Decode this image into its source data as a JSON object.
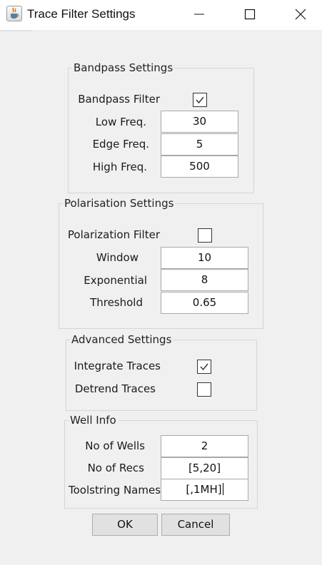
{
  "window": {
    "title": "Trace Filter Settings",
    "app_icon": "java-cup-icon"
  },
  "bandpass": {
    "legend": "Bandpass Settings",
    "filter_label": "Bandpass Filter",
    "filter_checked": true,
    "low_label": "Low Freq.",
    "low_value": "30",
    "edge_label": "Edge Freq.",
    "edge_value": "5",
    "high_label": "High Freq.",
    "high_value": "500"
  },
  "polarisation": {
    "legend": "Polarisation Settings",
    "filter_label": "Polarization Filter",
    "filter_checked": false,
    "window_label": "Window",
    "window_value": "10",
    "exponential_label": "Exponential",
    "exponential_value": "8",
    "threshold_label": "Threshold",
    "threshold_value": "0.65"
  },
  "advanced": {
    "legend": "Advanced Settings",
    "integrate_label": "Integrate Traces",
    "integrate_checked": true,
    "detrend_label": "Detrend Traces",
    "detrend_checked": false
  },
  "well": {
    "legend": "Well Info",
    "wells_label": "No of Wells",
    "wells_value": "2",
    "recs_label": "No of Recs",
    "recs_value": "[5,20]",
    "names_label": "Toolstring Names",
    "names_value": "[,1MH]"
  },
  "buttons": {
    "ok": "OK",
    "cancel": "Cancel"
  }
}
